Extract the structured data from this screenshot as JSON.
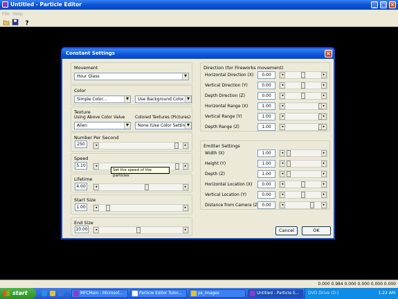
{
  "app": {
    "title": "Untitled - Particle Editor",
    "menu": [
      "File",
      "Help"
    ],
    "toolbar_icons": [
      "open-icon",
      "save-icon",
      "help-icon"
    ]
  },
  "dialog": {
    "title": "Constant Settings",
    "movement": {
      "legend": "Movement",
      "value": "Hour Glass"
    },
    "color": {
      "legend": "Color",
      "left_value": "Simple Color...",
      "right_value": "Use Background Color..."
    },
    "texture": {
      "legend": "Texture",
      "left_label": "Using Above Color Value",
      "right_label": "Colored Textures (Pictures)",
      "left_value": "Alien",
      "right_value": "None (Use Color Settings)"
    },
    "number_per_second": {
      "legend": "Number Per Second",
      "value": "250"
    },
    "speed": {
      "legend": "Speed",
      "value": "5.10",
      "tooltip": "Set the speed of the particles"
    },
    "lifetime": {
      "legend": "Lifetime",
      "value": "4.00"
    },
    "start_size": {
      "legend": "Start Size",
      "value": "1.00"
    },
    "end_size": {
      "legend": "End Size",
      "value": "10.00"
    },
    "direction": {
      "legend": "Direction (for Fireworks movement)",
      "rows": [
        {
          "label": "Horizontal Direction (X)",
          "value": "0.00"
        },
        {
          "label": "Vertical Direction (Y)",
          "value": "0.00"
        },
        {
          "label": "Depth Direction (Z)",
          "value": "0.00"
        },
        {
          "label": "Horizontal Range (X)",
          "value": "1.00"
        },
        {
          "label": "Vertical Range (Y)",
          "value": "1.00"
        },
        {
          "label": "Depth Range (Z)",
          "value": "1.00"
        }
      ]
    },
    "emitter": {
      "legend": "Emitter Settings",
      "rows": [
        {
          "label": "Width (X)",
          "value": "1.00"
        },
        {
          "label": "Height (Y)",
          "value": "1.00"
        },
        {
          "label": "Depth (Z)",
          "value": "1.00"
        },
        {
          "label": "Horizontal Location (X)",
          "value": "0.00"
        },
        {
          "label": "Vertical Location (Y)",
          "value": "0.00"
        },
        {
          "label": "Distance from Camera (Z)",
          "value": "0.00"
        }
      ]
    },
    "cancel_label": "Cancel",
    "ok_label": "OK"
  },
  "statusbar": {
    "text": "0.000 0.984 0.000 0.000 0.000 0.000"
  },
  "taskbar": {
    "start_label": "start",
    "tasks": [
      "MFCMain - Microsof...",
      "Particle Editor Tutor...",
      "ps_images",
      "Untitled - Particle E..."
    ],
    "tray_label": "DVD Drive (D:)",
    "clock": "1:22 AM"
  }
}
